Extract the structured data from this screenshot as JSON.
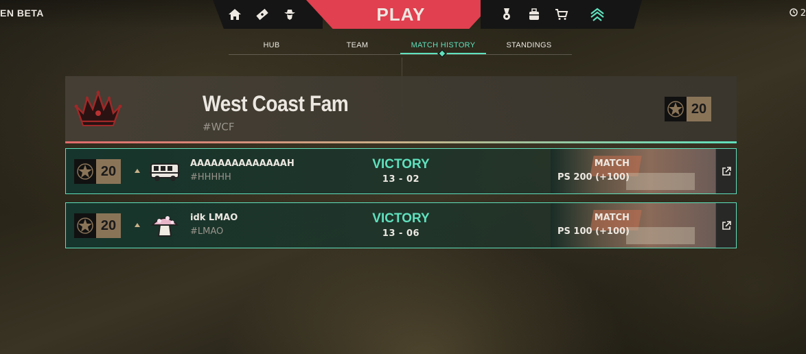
{
  "topbar": {
    "beta_text": "EN BETA",
    "play_label": "PLAY",
    "clock_text": "2",
    "left_nav_icons": [
      "home-icon",
      "ticket-icon",
      "agent-icon"
    ],
    "right_nav_icons": [
      "medal-icon",
      "backpack-icon",
      "cart-icon",
      "chevron-up-icon"
    ]
  },
  "tabs": [
    {
      "label": "HUB",
      "active": false
    },
    {
      "label": "TEAM",
      "active": false
    },
    {
      "label": "MATCH HISTORY",
      "active": true
    },
    {
      "label": "STANDINGS",
      "active": false
    }
  ],
  "team": {
    "name": "West Coast Fam",
    "tag": "#WCF",
    "rank": "20",
    "logo_icon": "crown-icon"
  },
  "matches": [
    {
      "rank": "20",
      "player_name": "AAAAAAAAAAAAAAH",
      "player_tag": "#HHHHH",
      "player_icon": "bus-icon",
      "result": "VICTORY",
      "score": "13 - 02",
      "mode": "MATCH",
      "ps": "PS 200 (+100)"
    },
    {
      "rank": "20",
      "player_name": "idk LMAO",
      "player_tag": "#LMAO",
      "player_icon": "mushroom-icon",
      "result": "VICTORY",
      "score": "13 - 06",
      "mode": "MATCH",
      "ps": "PS 100 (+100)"
    }
  ],
  "colors": {
    "accent": "#5fe1bd",
    "play": "#e0404f",
    "rank_bg": "#8a7458"
  }
}
